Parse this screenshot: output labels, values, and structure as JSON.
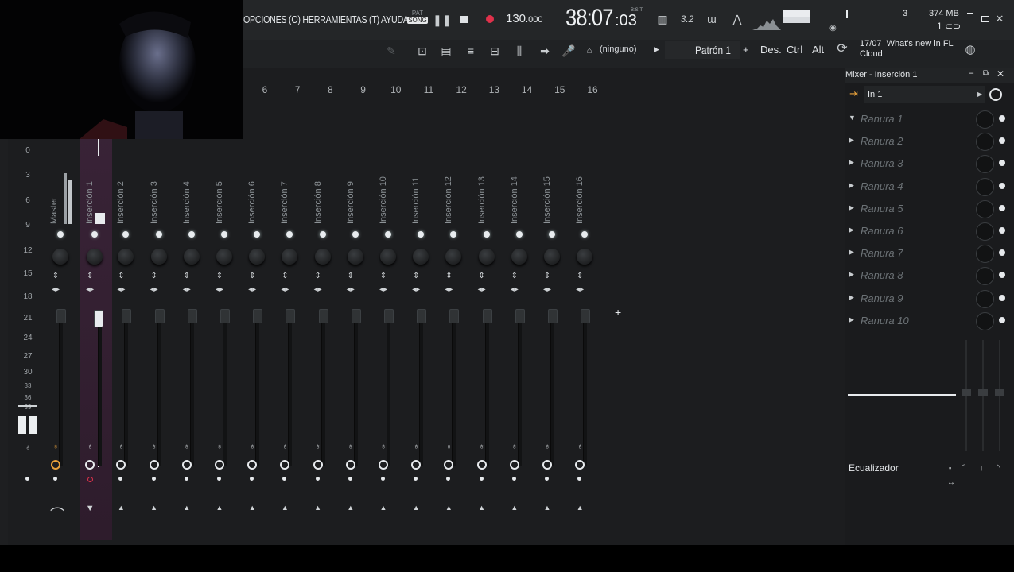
{
  "menu": {
    "text": "OPCIONES (O) HERRAMIENTAS (T) AYUDA"
  },
  "transport": {
    "pat_label": "PAT",
    "song_label": "SONG",
    "tempo": "130",
    "tempo_decimals": ".000",
    "time_main": "38:07",
    "time_sub": ":03",
    "time_unit": "B:S:T"
  },
  "system": {
    "cpu_value": "3",
    "memory": "374 MB",
    "voices": "1"
  },
  "toolbar": {
    "pattern_none": "(ninguno)",
    "pattern_name": "Patrón 1",
    "pattern_add": "+",
    "undo_label": "Des.",
    "ctrl_label": "Ctrl",
    "alt_label": "Alt",
    "news_date": "17/07",
    "news_text_line1": "What's new in FL",
    "news_text_line2": "Cloud"
  },
  "mixer": {
    "column_numbers": [
      "6",
      "7",
      "8",
      "9",
      "10",
      "11",
      "12",
      "13",
      "14",
      "15",
      "16"
    ],
    "scale": [
      "0",
      "3",
      "6",
      "9",
      "12",
      "15",
      "18",
      "21",
      "24",
      "27",
      "30",
      "33",
      "36",
      "39"
    ],
    "strips": [
      {
        "name": "Master"
      },
      {
        "name": "Inserción 1"
      },
      {
        "name": "Inserción 2"
      },
      {
        "name": "Inserción 3"
      },
      {
        "name": "Inserción 4"
      },
      {
        "name": "Inserción 5"
      },
      {
        "name": "Inserción 6"
      },
      {
        "name": "Inserción 7"
      },
      {
        "name": "Inserción 8"
      },
      {
        "name": "Inserción 9"
      },
      {
        "name": "Inserción 10"
      },
      {
        "name": "Inserción 11"
      },
      {
        "name": "Inserción 12"
      },
      {
        "name": "Inserción 13"
      },
      {
        "name": "Inserción 14"
      },
      {
        "name": "Inserción 15"
      },
      {
        "name": "Inserción 16"
      }
    ],
    "selected_strip": "Inserción 1",
    "add_button": "+"
  },
  "panel": {
    "title": "Mixer - Inserción 1",
    "input": "In 1",
    "slots": [
      "Ranura 1",
      "Ranura 2",
      "Ranura 3",
      "Ranura 4",
      "Ranura 5",
      "Ranura 6",
      "Ranura 7",
      "Ranura 8",
      "Ranura 9",
      "Ranura 10"
    ],
    "eq_label": "Ecualizador"
  },
  "colors": {
    "accent_purple": "#5a2f55",
    "record_red": "#e0314b",
    "link_orange": "#e9a23b"
  },
  "icons": [
    "pause-icon",
    "stop-icon",
    "record-icon",
    "piano-icon",
    "swing-icon",
    "metronome-icon",
    "minimize-icon",
    "maximize-icon",
    "close-icon",
    "globe-icon",
    "clock-icon"
  ]
}
